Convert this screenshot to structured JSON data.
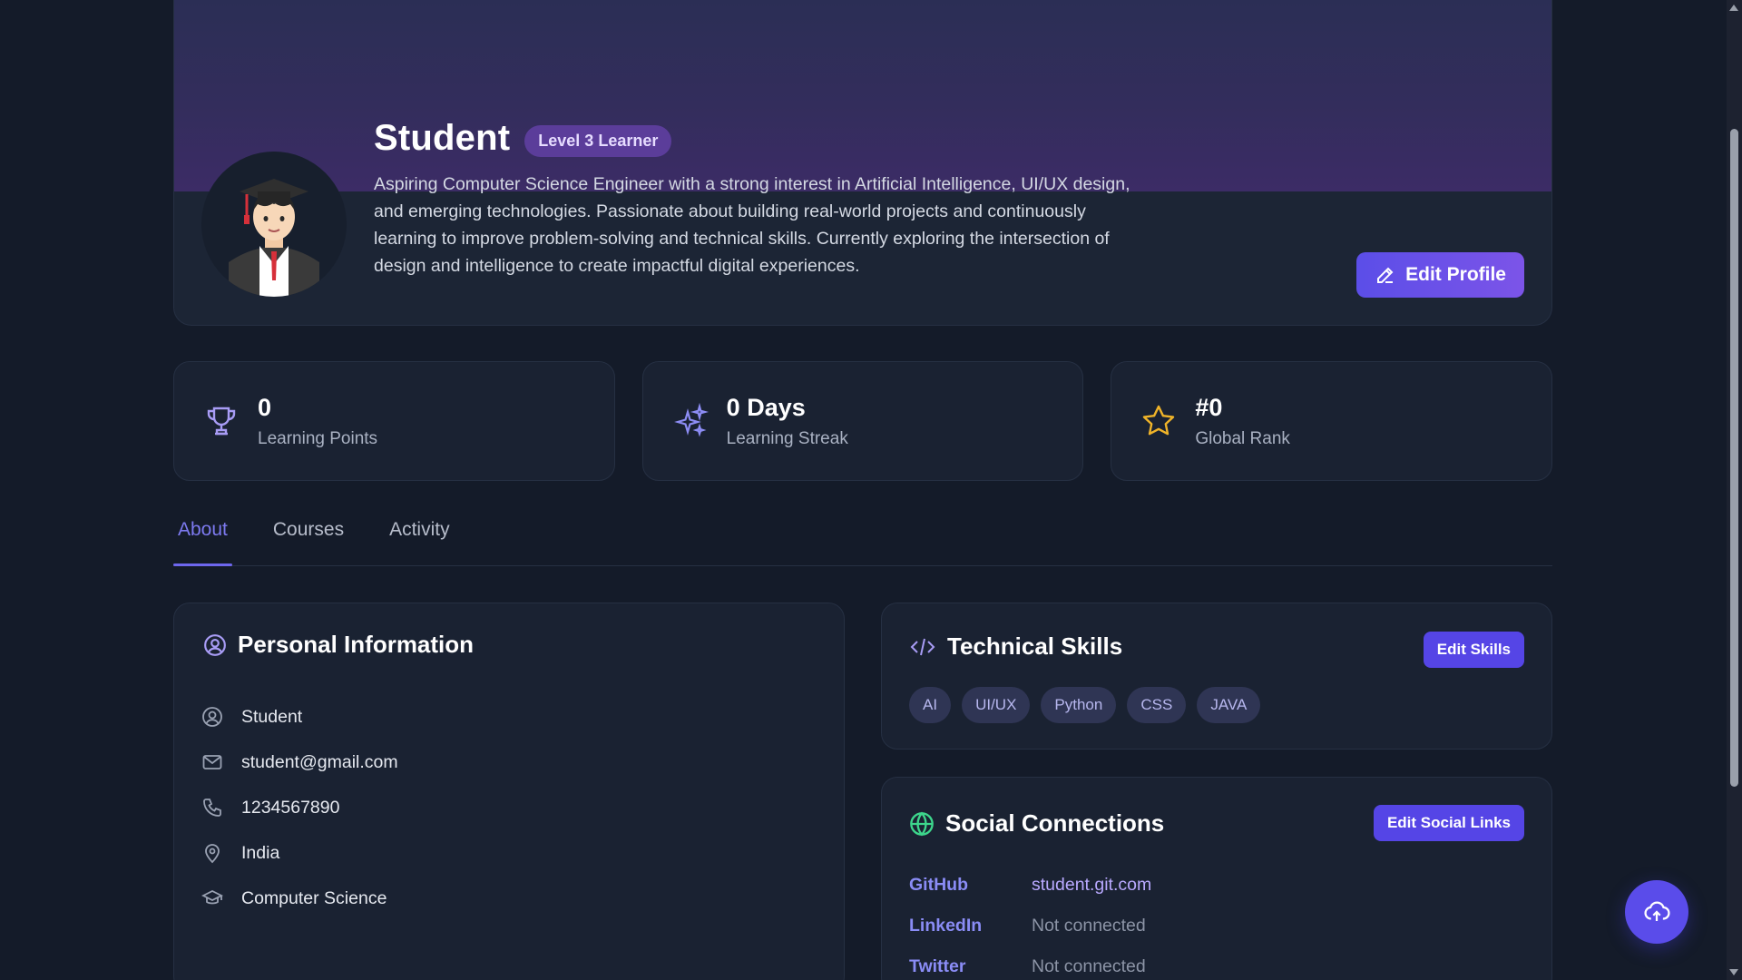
{
  "profile": {
    "name": "Student",
    "level_badge": "Level 3 Learner",
    "bio": "Aspiring Computer Science Engineer with a strong interest in Artificial Intelligence, UI/UX design, and emerging technologies. Passionate about building real-world projects and continuously learning to improve problem-solving and technical skills. Currently exploring the intersection of design and intelligence to create impactful digital experiences.",
    "edit_button": "Edit Profile",
    "avatar_icon": "graduate-avatar"
  },
  "stats": [
    {
      "value": "0",
      "label": "Learning Points",
      "icon": "trophy-icon"
    },
    {
      "value": "0 Days",
      "label": "Learning Streak",
      "icon": "sparkles-icon"
    },
    {
      "value": "#0",
      "label": "Global Rank",
      "icon": "star-icon"
    }
  ],
  "tabs": [
    {
      "label": "About",
      "active": true
    },
    {
      "label": "Courses",
      "active": false
    },
    {
      "label": "Activity",
      "active": false
    }
  ],
  "personal": {
    "title": "Personal Information",
    "items": [
      {
        "icon": "user-icon",
        "value": "Student"
      },
      {
        "icon": "mail-icon",
        "value": "student@gmail.com"
      },
      {
        "icon": "phone-icon",
        "value": "1234567890"
      },
      {
        "icon": "location-icon",
        "value": "India"
      },
      {
        "icon": "graduation-cap-icon",
        "value": "Computer Science"
      }
    ]
  },
  "skills": {
    "title": "Technical Skills",
    "edit_button": "Edit Skills",
    "tags": [
      "AI",
      "UI/UX",
      "Python",
      "CSS",
      "JAVA"
    ]
  },
  "social": {
    "title": "Social Connections",
    "edit_button": "Edit Social Links",
    "links": [
      {
        "name": "GitHub",
        "value": "student.git.com",
        "connected": true
      },
      {
        "name": "LinkedIn",
        "value": "Not connected",
        "connected": false
      },
      {
        "name": "Twitter",
        "value": "Not connected",
        "connected": false
      }
    ]
  },
  "colors": {
    "accent": "#5b4ee8",
    "background": "#141b29",
    "card": "#1a2232",
    "badge": "#5b3d9a"
  }
}
